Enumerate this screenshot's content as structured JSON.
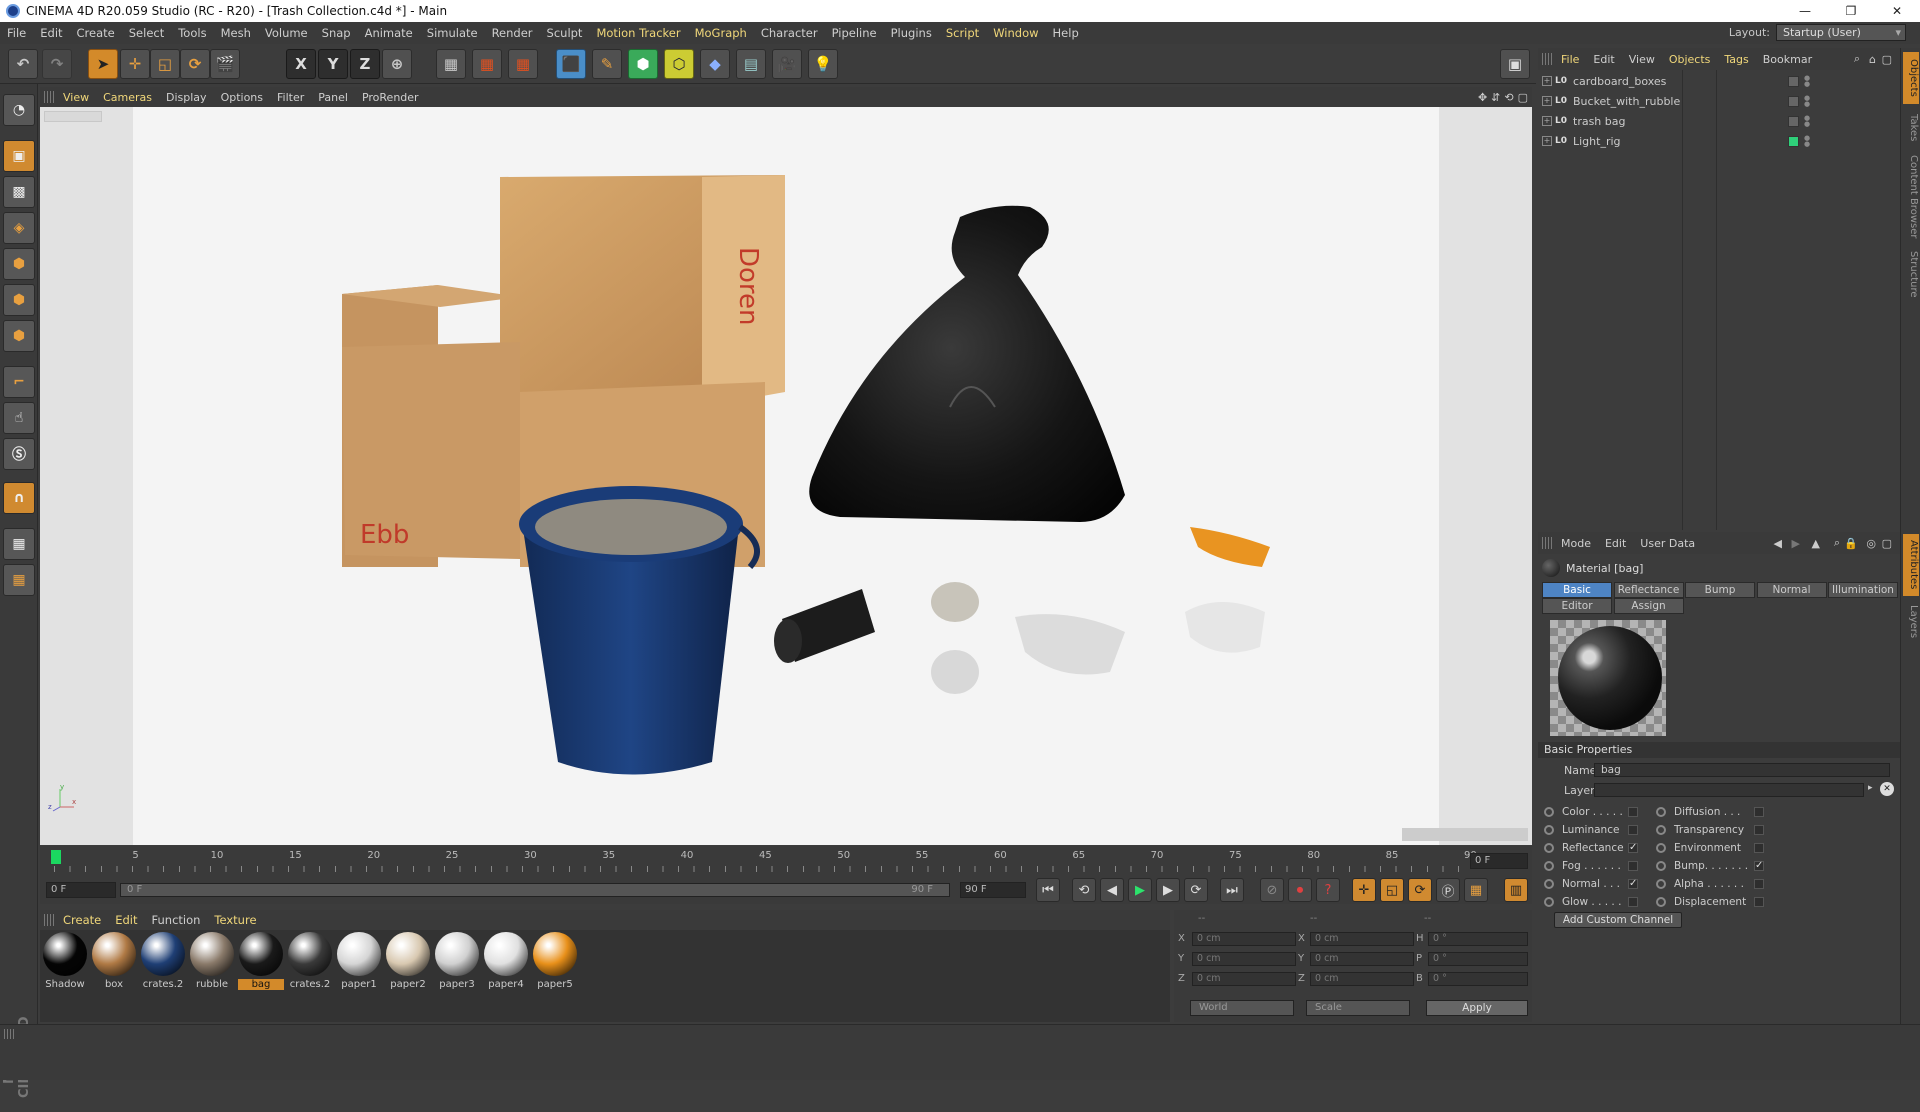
{
  "window": {
    "title": "CINEMA 4D R20.059 Studio (RC - R20) - [Trash Collection.c4d *] - Main",
    "controls": [
      "—",
      "❐",
      "✕"
    ]
  },
  "menubar": {
    "items": [
      "File",
      "Edit",
      "Create",
      "Select",
      "Tools",
      "Mesh",
      "Volume",
      "Snap",
      "Animate",
      "Simulate",
      "Render",
      "Sculpt",
      "Motion Tracker",
      "MoGraph",
      "Character",
      "Pipeline",
      "Plugins",
      "Script",
      "Window",
      "Help"
    ],
    "highlighted": [
      "Motion Tracker",
      "MoGraph",
      "Script",
      "Window"
    ],
    "layout_label": "Layout:",
    "layout_value": "Startup (User)"
  },
  "toolbar": {
    "axis_buttons": [
      "X",
      "Y",
      "Z"
    ]
  },
  "viewport": {
    "menu": [
      "View",
      "Cameras",
      "Display",
      "Options",
      "Filter",
      "Panel",
      "ProRender"
    ],
    "highlighted": [
      "View",
      "Cameras"
    ],
    "axis_labels": {
      "y": "y",
      "z": "z",
      "x": "x"
    }
  },
  "timeline": {
    "ticks": [
      "0",
      "5",
      "10",
      "15",
      "20",
      "25",
      "30",
      "35",
      "40",
      "45",
      "50",
      "55",
      "60",
      "65",
      "70",
      "75",
      "80",
      "85",
      "90"
    ],
    "current_frame": "0 F",
    "start_frame": "0 F",
    "slider_start": "0 F",
    "slider_end": "90 F",
    "end_frame": "90 F"
  },
  "material_manager": {
    "menu": [
      "Create",
      "Edit",
      "Function",
      "Texture"
    ],
    "highlighted": [
      "Create",
      "Edit",
      "Texture"
    ],
    "materials": [
      {
        "name": "Shadow",
        "color": "#050505"
      },
      {
        "name": "box",
        "color": "#b07a45"
      },
      {
        "name": "crates.2",
        "color": "#1f3f75"
      },
      {
        "name": "rubble",
        "color": "#8a7a6a"
      },
      {
        "name": "bag",
        "color": "#1a1a1a",
        "selected": true
      },
      {
        "name": "crates.2",
        "color": "#3a3a3a"
      },
      {
        "name": "paper1",
        "color": "#d5d5d5"
      },
      {
        "name": "paper2",
        "color": "#d8c8b0"
      },
      {
        "name": "paper3",
        "color": "#d0d0d0"
      },
      {
        "name": "paper4",
        "color": "#e0e0e0"
      },
      {
        "name": "paper5",
        "color": "#e8901a"
      }
    ]
  },
  "coordinates": {
    "header": [
      "--",
      "--",
      "--"
    ],
    "rows": [
      {
        "a": "X",
        "av": "0 cm",
        "b": "X",
        "bv": "0 cm",
        "c": "H",
        "cv": "0 °"
      },
      {
        "a": "Y",
        "av": "0 cm",
        "b": "Y",
        "bv": "0 cm",
        "c": "P",
        "cv": "0 °"
      },
      {
        "a": "Z",
        "av": "0 cm",
        "b": "Z",
        "bv": "0 cm",
        "c": "B",
        "cv": "0 °"
      }
    ],
    "world": "World",
    "scale": "Scale",
    "apply": "Apply"
  },
  "objects": {
    "menu": [
      "File",
      "Edit",
      "View",
      "Objects",
      "Tags",
      "Bookmar"
    ],
    "highlighted": [
      "File",
      "Objects",
      "Tags"
    ],
    "items": [
      {
        "name": "cardboard_boxes",
        "tag": "L0"
      },
      {
        "name": "Bucket_with_rubble",
        "tag": "L0"
      },
      {
        "name": "trash bag",
        "tag": "L0"
      },
      {
        "name": "Light_rig",
        "tag": "L0"
      }
    ]
  },
  "side_tabs": {
    "top": [
      "Objects",
      "Takes",
      "Content Browser",
      "Structure"
    ],
    "bottom": [
      "Attributes",
      "Layers"
    ]
  },
  "attributes": {
    "menu": [
      "Mode",
      "Edit",
      "User Data"
    ],
    "material_title": "Material [bag]",
    "tabs_row1": [
      "Basic",
      "Reflectance",
      "Bump",
      "Normal",
      "Illumination"
    ],
    "tabs_row2": [
      "Editor",
      "Assign"
    ],
    "section": "Basic Properties",
    "name_label": "Name",
    "name_value": "bag",
    "layer_label": "Layer",
    "channels_left": [
      {
        "label": "Color . . . . .",
        "checked": false
      },
      {
        "label": "Luminance",
        "checked": false
      },
      {
        "label": "Reflectance",
        "checked": true
      },
      {
        "label": "Fog . . . . . .",
        "checked": false
      },
      {
        "label": "Normal . . .",
        "checked": true
      },
      {
        "label": "Glow . . . . .",
        "checked": false
      }
    ],
    "channels_right": [
      {
        "label": "Diffusion . . .",
        "checked": false
      },
      {
        "label": "Transparency",
        "checked": false
      },
      {
        "label": "Environment",
        "checked": false
      },
      {
        "label": "Bump. . . . . . .",
        "checked": true
      },
      {
        "label": "Alpha . . . . . .",
        "checked": false
      },
      {
        "label": "Displacement",
        "checked": false
      }
    ],
    "add_channel": "Add Custom Channel"
  },
  "brand": "MAXON CINEMA 4D"
}
